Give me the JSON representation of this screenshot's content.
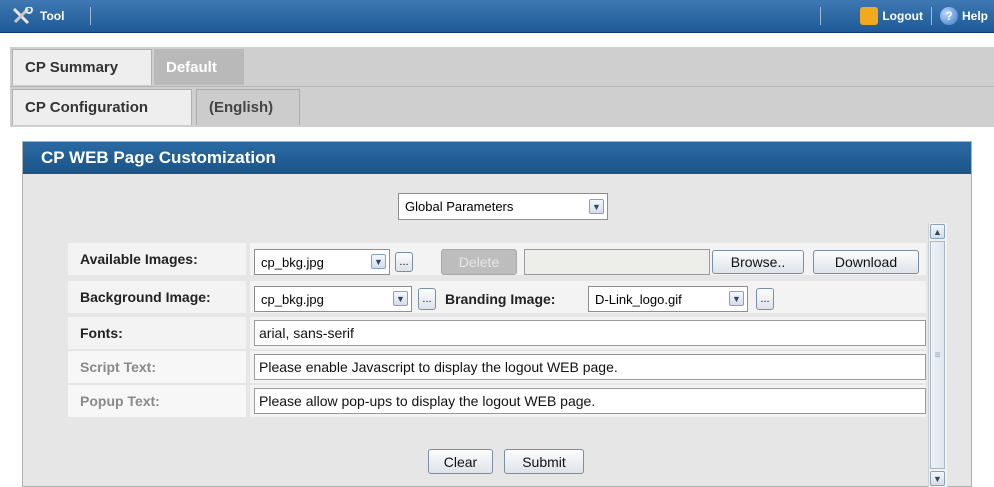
{
  "topbar": {
    "tool_label": "Tool",
    "logout_label": "Logout",
    "help_label": "Help"
  },
  "tabs_primary": [
    {
      "label": "CP Summary",
      "active": true
    },
    {
      "label": "Default",
      "active": false
    }
  ],
  "tabs_secondary": [
    {
      "label": "CP Configuration",
      "active": true
    },
    {
      "label": "(English)",
      "active": false
    }
  ],
  "panel": {
    "title": "CP WEB Page Customization",
    "param_select": "Global Parameters"
  },
  "form": {
    "available_images": {
      "label": "Available Images:",
      "value": "cp_bkg.jpg",
      "more": "...",
      "delete": "Delete",
      "browse": "Browse..",
      "download": "Download"
    },
    "background_image": {
      "label": "Background Image:",
      "value": "cp_bkg.jpg",
      "more": "...",
      "branding_label": "Branding Image:",
      "branding_value": "D-Link_logo.gif",
      "branding_more": "..."
    },
    "fonts": {
      "label": "Fonts:",
      "value": "arial, sans-serif"
    },
    "script_text": {
      "label": "Script Text:",
      "value": "Please enable Javascript to display the logout WEB page."
    },
    "popup_text": {
      "label": "Popup Text:",
      "value": "Please allow pop-ups to display the logout WEB page."
    }
  },
  "actions": {
    "clear": "Clear",
    "submit": "Submit"
  },
  "colors": {
    "header_blue": "#1b5488",
    "topbar_blue": "#2a66a6"
  }
}
